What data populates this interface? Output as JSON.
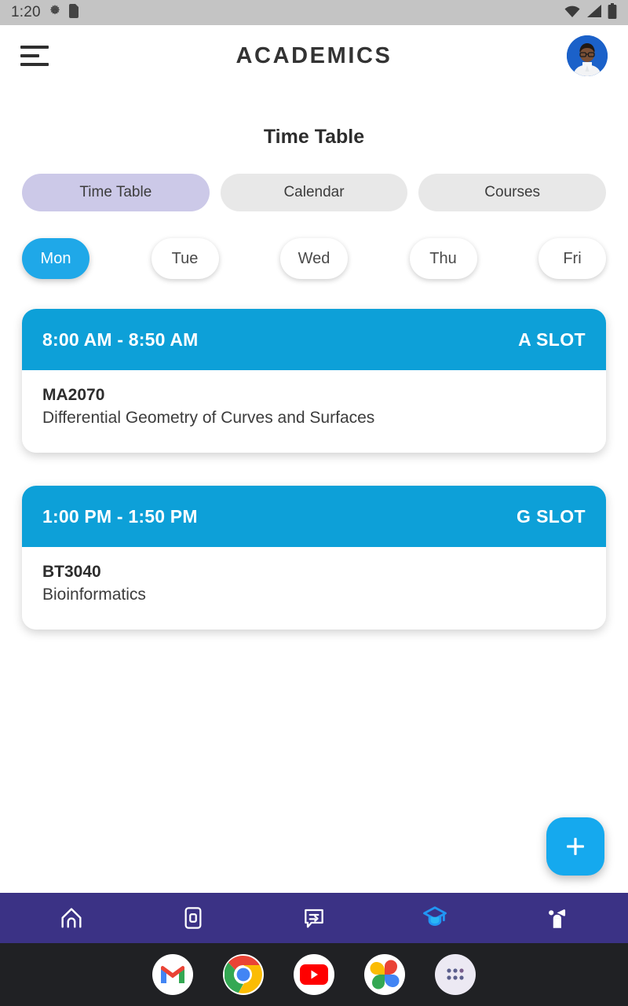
{
  "status_bar": {
    "clock": "1:20",
    "icons": [
      "debug-settings-icon",
      "sd-card-icon",
      "wifi-icon",
      "signal-icon",
      "battery-icon"
    ]
  },
  "app_bar": {
    "menu_icon": "hamburger-menu-icon",
    "title": "ACADEMICS",
    "avatar": "user-profile-photo"
  },
  "page": {
    "title": "Time Table"
  },
  "tabs": [
    {
      "label": "Time Table",
      "active": true
    },
    {
      "label": "Calendar",
      "active": false
    },
    {
      "label": "Courses",
      "active": false
    }
  ],
  "days": [
    {
      "label": "Mon",
      "active": true
    },
    {
      "label": "Tue",
      "active": false
    },
    {
      "label": "Wed",
      "active": false
    },
    {
      "label": "Thu",
      "active": false
    },
    {
      "label": "Fri",
      "active": false
    }
  ],
  "classes": [
    {
      "time": "8:00 AM - 8:50 AM",
      "slot": "A SLOT",
      "code": "MA2070",
      "name": "Differential Geometry of Curves and Surfaces"
    },
    {
      "time": "1:00 PM - 1:50 PM",
      "slot": "G SLOT",
      "code": "BT3040",
      "name": "Bioinformatics"
    }
  ],
  "fab": {
    "label": "+",
    "icon": "plus-icon"
  },
  "bottom_nav": [
    {
      "icon": "home-icon",
      "active": false
    },
    {
      "icon": "square-card-icon",
      "active": false
    },
    {
      "icon": "chat-bubble-icon",
      "active": false
    },
    {
      "icon": "graduation-cap-icon",
      "active": true
    },
    {
      "icon": "announcement-icon",
      "active": false
    }
  ],
  "dock": [
    {
      "icon": "gmail-icon"
    },
    {
      "icon": "chrome-icon"
    },
    {
      "icon": "youtube-icon"
    },
    {
      "icon": "google-photos-icon"
    },
    {
      "icon": "app-drawer-icon"
    }
  ],
  "colors": {
    "accent_blue": "#0DA0D8",
    "chip_blue": "#1FA8E8",
    "fab_blue": "#15A9EE",
    "nav_indigo": "#3B3285",
    "active_tab_lavender": "#ccc9e8",
    "inactive_tab_gray": "#e8e8e8",
    "status_bar_gray": "#c4c4c4",
    "dock_dark": "#202124"
  }
}
